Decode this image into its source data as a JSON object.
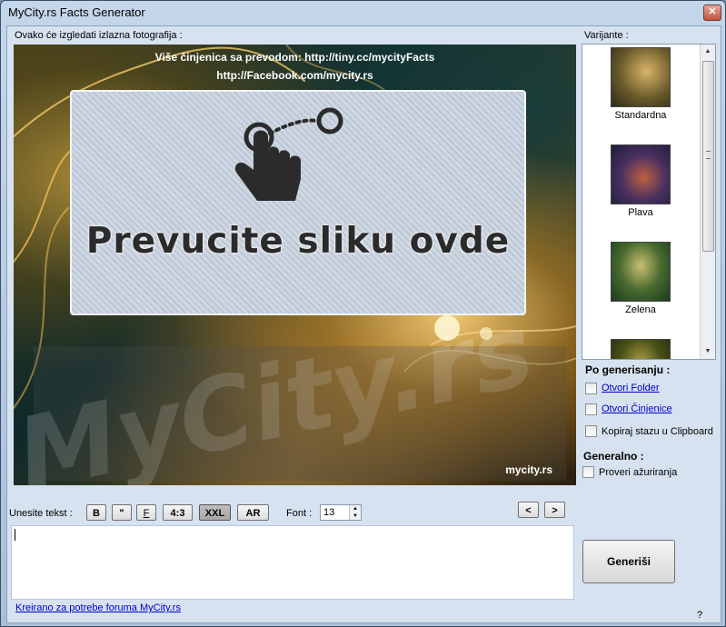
{
  "window": {
    "title": "MyCity.rs Facts Generator",
    "close_glyph": "✕"
  },
  "preview": {
    "label": "Ovako će izgledati izlazna fotografija :",
    "line1": "Više činjenica sa prevodom: http://tiny.cc/mycityFacts",
    "line2": "http://Facebook.com/mycity.rs",
    "drop_text": "Prevucite sliku ovde",
    "watermark": "MyCity.rs",
    "brand": "mycity.rs"
  },
  "toolbar": {
    "text_label": "Unesite tekst :",
    "bold": "B",
    "quote": "\"",
    "font_f": "F",
    "ratio": "4:3",
    "xxl": "XXL",
    "ar": "AR",
    "font_label": "Font :",
    "font_size": "13",
    "prev": "<",
    "next": ">"
  },
  "text_input": {
    "value": ""
  },
  "footer": {
    "link": "Kreirano za potrebe foruma MyCity.rs",
    "help": "?"
  },
  "variants": {
    "label": "Varijante :",
    "items": [
      {
        "label": "Standardna",
        "tone": "#5a4a20"
      },
      {
        "label": "Plava",
        "tone": "#2a2e58"
      },
      {
        "label": "Zelena",
        "tone": "#1f4a28"
      },
      {
        "label": "",
        "tone": "#3f4a1a"
      }
    ]
  },
  "after_generate": {
    "title": "Po generisanju :",
    "open_folder": "Otvori Folder",
    "open_fact": "Otvori Činjenice",
    "copy_path": "Kopiraj stazu u Clipboard"
  },
  "general": {
    "title": "Generalno :",
    "check_updates": "Proveri ažuriranja"
  },
  "generate_button": "Generiši"
}
